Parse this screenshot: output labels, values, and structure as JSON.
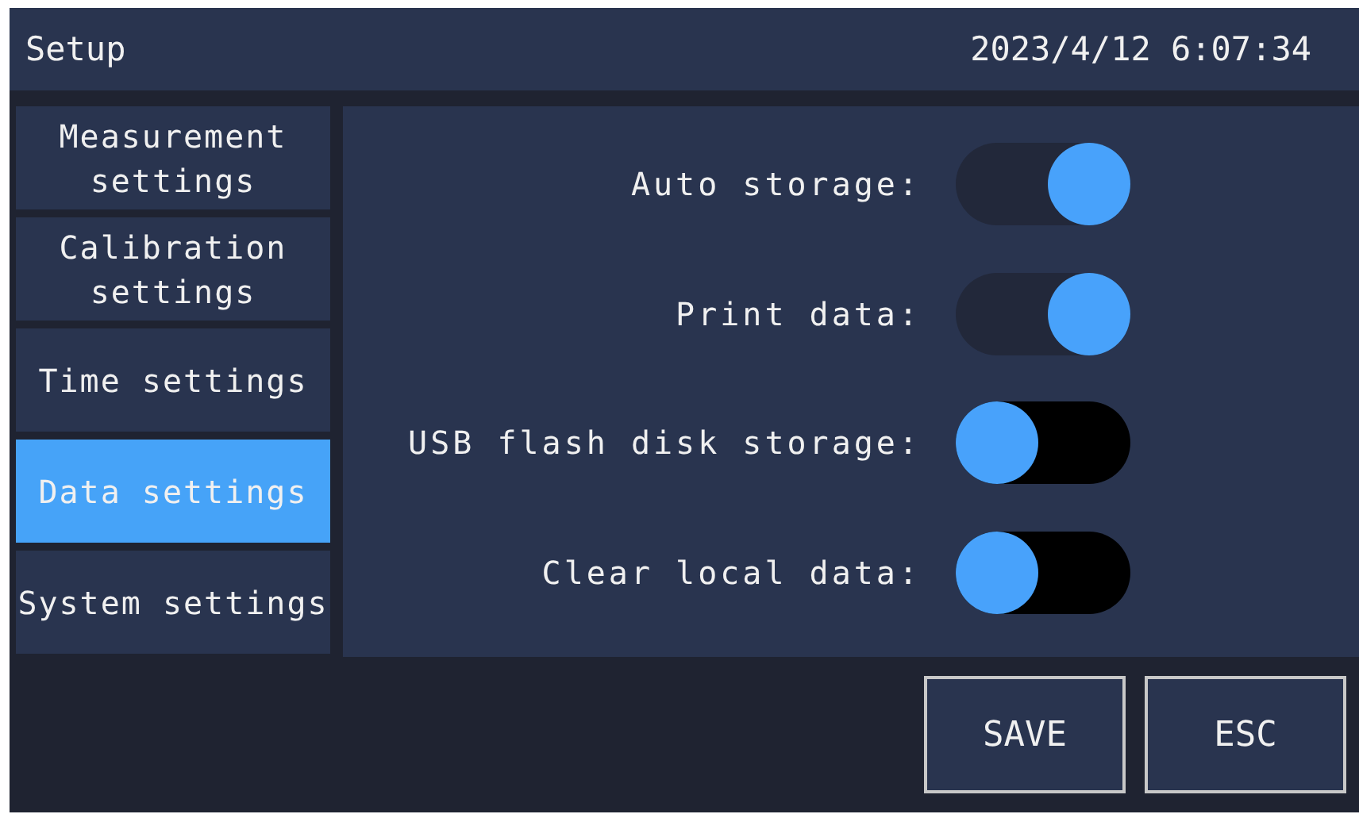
{
  "header": {
    "title": "Setup",
    "datetime": "2023/4/12 6:07:34"
  },
  "sidebar": {
    "items": [
      {
        "label": "Measurement settings",
        "selected": false
      },
      {
        "label": "Calibration settings",
        "selected": false
      },
      {
        "label": "Time settings",
        "selected": false
      },
      {
        "label": "Data settings",
        "selected": true
      },
      {
        "label": "System settings",
        "selected": false
      }
    ]
  },
  "settings": [
    {
      "label": "Auto storage:",
      "on": true
    },
    {
      "label": "Print data:",
      "on": true
    },
    {
      "label": "USB flash disk storage:",
      "on": false
    },
    {
      "label": "Clear local data:",
      "on": false
    }
  ],
  "buttons": [
    "SAVE",
    "ESC"
  ]
}
